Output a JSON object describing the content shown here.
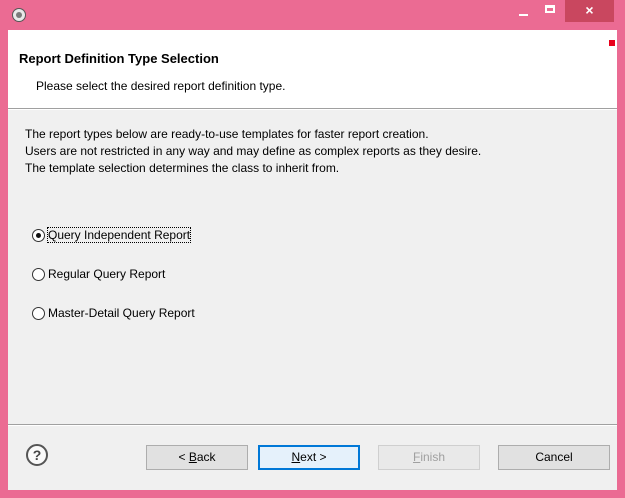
{
  "window": {
    "icon": "eclipse-app-icon",
    "title": "",
    "controls": {
      "minimize": "minimize-icon",
      "maximize": "maximize-icon",
      "close_glyph": "×"
    }
  },
  "header": {
    "title": "Report Definition Type Selection",
    "message": "Please select the desired report definition type."
  },
  "description": [
    "The report types below are ready-to-use templates for faster report creation.",
    "Users are not restricted in any way and may define as complex reports as they desire.",
    "The template selection determines the class to inherit from."
  ],
  "options": [
    {
      "label": "Query Independent Report",
      "selected": true
    },
    {
      "label": "Regular Query Report",
      "selected": false
    },
    {
      "label": "Master-Detail Query Report",
      "selected": false
    }
  ],
  "footer": {
    "help_glyph": "?",
    "back": {
      "prefix": "< ",
      "mnemonic": "B",
      "rest": "ack"
    },
    "next": {
      "mnemonic": "N",
      "rest": "ext >"
    },
    "finish": {
      "mnemonic": "F",
      "rest": "inish",
      "enabled": false
    },
    "cancel": "Cancel"
  },
  "colors": {
    "titlebar": "#eb6b93",
    "close_button": "#c9475f",
    "accent": "#0078d7"
  }
}
